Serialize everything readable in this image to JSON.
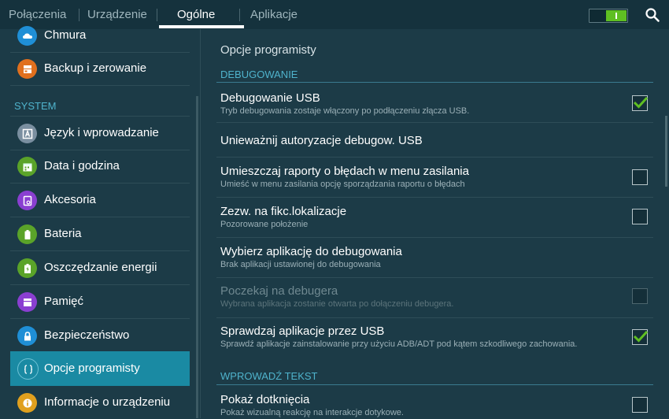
{
  "tabs": [
    {
      "label": "Połączenia"
    },
    {
      "label": "Urządzenie"
    },
    {
      "label": "Ogólne"
    },
    {
      "label": "Aplikacje"
    }
  ],
  "active_tab": "Ogólne",
  "sidebar": {
    "items_top": [
      {
        "label": "Chmura",
        "icon": "cloud-icon",
        "color": "#1f8fd6"
      },
      {
        "label": "Backup i zerowanie",
        "icon": "backup-icon",
        "color": "#e0701e"
      }
    ],
    "section_header": "SYSTEM",
    "items": [
      {
        "label": "Język i wprowadzanie",
        "icon": "language-icon",
        "color": "#7a8fa0"
      },
      {
        "label": "Data i godzina",
        "icon": "calendar-icon",
        "color": "#5aa329"
      },
      {
        "label": "Akcesoria",
        "icon": "accessories-icon",
        "color": "#8a3fd1"
      },
      {
        "label": "Bateria",
        "icon": "battery-icon",
        "color": "#5aa329"
      },
      {
        "label": "Oszczędzanie energii",
        "icon": "power-saving-icon",
        "color": "#5aa329"
      },
      {
        "label": "Pamięć",
        "icon": "storage-icon",
        "color": "#8a3fd1"
      },
      {
        "label": "Bezpieczeństwo",
        "icon": "lock-icon",
        "color": "#1f8fd6"
      },
      {
        "label": "Opcje programisty",
        "icon": "developer-icon",
        "color": "#1a8aa3",
        "selected": true
      },
      {
        "label": "Informacje o urządzeniu",
        "icon": "info-icon",
        "color": "#e0a01e"
      }
    ]
  },
  "main": {
    "title": "Opcje programisty",
    "section1": "DEBUGOWANIE",
    "section2": "WPROWADŹ TEKST",
    "rows": [
      {
        "title": "Debugowanie USB",
        "subtitle": "Tryb debugowania zostaje włączony po podłączeniu złącza USB.",
        "checkbox": true,
        "checked": true
      },
      {
        "title": "Unieważnij autoryzacje debugow. USB",
        "subtitle": "",
        "checkbox": false
      },
      {
        "title": "Umieszczaj raporty o błędach w menu zasilania",
        "subtitle": "Umieść w menu zasilania opcję sporządzania raportu o błędach",
        "checkbox": true,
        "checked": false
      },
      {
        "title": "Zezw. na fikc.lokalizacje",
        "subtitle": "Pozorowane położenie",
        "checkbox": true,
        "checked": false
      },
      {
        "title": "Wybierz aplikację do debugowania",
        "subtitle": "Brak aplikacji ustawionej do debugowania",
        "checkbox": false
      },
      {
        "title": "Poczekaj na debugera",
        "subtitle": "Wybrana aplikacja zostanie otwarta po dołączeniu debugera.",
        "checkbox": true,
        "checked": false,
        "disabled": true
      },
      {
        "title": "Sprawdzaj aplikacje przez USB",
        "subtitle": "Sprawdź aplikacje zainstalowanie przy użyciu ADB/ADT pod kątem szkodliwego zachowania.",
        "checkbox": true,
        "checked": true
      }
    ],
    "rows2": [
      {
        "title": "Pokaż dotknięcia",
        "subtitle": "Pokaż wizualną reakcję na interakcje dotykowe.",
        "checkbox": true,
        "checked": false
      }
    ]
  },
  "toggle": {
    "state": "on",
    "color": "#5fbf22"
  },
  "colors": {
    "accent": "#4fb3cc",
    "selected": "#1a8aa3",
    "background": "#1c3b47"
  }
}
